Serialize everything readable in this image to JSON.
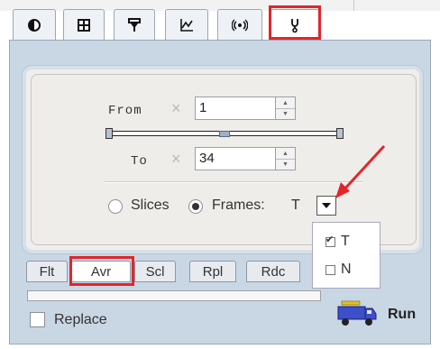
{
  "tabs": [
    {
      "icon": "contrast-icon"
    },
    {
      "icon": "grid-icon"
    },
    {
      "icon": "filter-icon"
    },
    {
      "icon": "chart-icon"
    },
    {
      "icon": "signal-icon"
    },
    {
      "icon": "stethoscope-icon",
      "active": true
    }
  ],
  "range": {
    "from_label": "From",
    "to_label": "To",
    "times_symbol": "×",
    "from_value": "1",
    "to_value": "34"
  },
  "mode": {
    "slices_label": "Slices",
    "frames_label": "Frames:",
    "selected": "Frames",
    "dimension_value": "T",
    "dropdown_options": [
      {
        "label": "T",
        "checked": true
      },
      {
        "label": "N",
        "checked": false
      }
    ]
  },
  "bottom_tabs": [
    "Flt",
    "Avr",
    "Scl",
    "Rpl",
    "Rdc"
  ],
  "bottom_active": "Avr",
  "replace_label": "Replace",
  "run_label": "Run",
  "colors": {
    "highlight": "#e3252b",
    "panel": "#c9d6e4"
  }
}
